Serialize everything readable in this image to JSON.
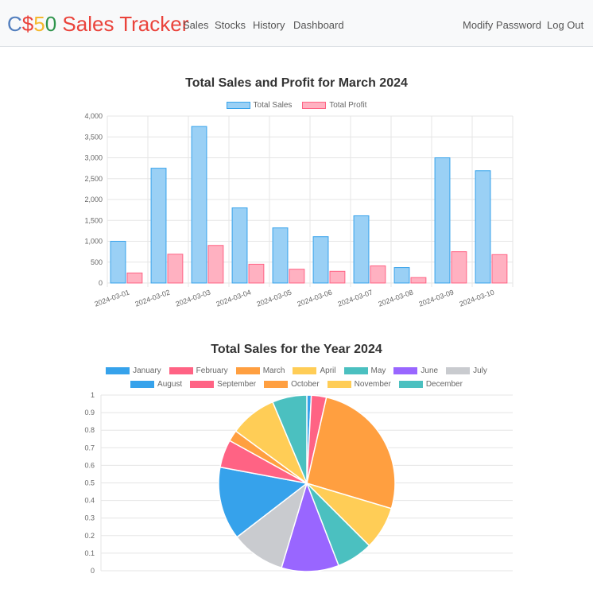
{
  "navbar": {
    "brand": {
      "c": "C",
      "dollar": "$",
      "five": "5",
      "zero": "0",
      "rest": " Sales Tracker"
    },
    "links": [
      "Sales",
      "Stocks",
      "History",
      "Dashboard"
    ],
    "right_links": [
      "Modify Password",
      "Log Out"
    ]
  },
  "chart_data": [
    {
      "type": "bar",
      "title": "Total Sales and Profit for March 2024",
      "categories": [
        "2024-03-01",
        "2024-03-02",
        "2024-03-03",
        "2024-03-04",
        "2024-03-05",
        "2024-03-06",
        "2024-03-07",
        "2024-03-08",
        "2024-03-09",
        "2024-03-10"
      ],
      "series": [
        {
          "name": "Total Sales",
          "values": [
            1000,
            2750,
            3750,
            1800,
            1320,
            1110,
            1610,
            370,
            3000,
            2690
          ],
          "color": "#9ad0f5",
          "border": "#36a2eb"
        },
        {
          "name": "Total Profit",
          "values": [
            240,
            690,
            900,
            450,
            330,
            280,
            410,
            130,
            750,
            680
          ],
          "color": "#ffb1c1",
          "border": "#ff6384"
        }
      ],
      "yticks": [
        "0",
        "500",
        "1,000",
        "1,500",
        "2,000",
        "2,500",
        "3,000",
        "3,500",
        "4,000"
      ],
      "ylim": [
        0,
        4000
      ],
      "grid": true,
      "legend": "top"
    },
    {
      "type": "pie",
      "title": "Total Sales for the Year 2024",
      "categories": [
        "January",
        "February",
        "March",
        "April",
        "May",
        "June",
        "July",
        "August",
        "September",
        "October",
        "November",
        "December"
      ],
      "colors": [
        "#36a2eb",
        "#ff6384",
        "#ff9f40",
        "#ffcd56",
        "#4bc0c0",
        "#9966ff",
        "#c9cbcf",
        "#36a2eb",
        "#ff6384",
        "#ff9f40",
        "#ffcd56",
        "#4bc0c0"
      ],
      "values": [
        0.8,
        2.7,
        25.5,
        7.7,
        6.5,
        10.3,
        9.7,
        13.1,
        5.0,
        2.0,
        8.4,
        6.2
      ],
      "yticks": [
        "0",
        "0.1",
        "0.2",
        "0.3",
        "0.4",
        "0.5",
        "0.6",
        "0.7",
        "0.8",
        "0.9",
        "1"
      ],
      "grid": true,
      "legend": "top"
    }
  ]
}
